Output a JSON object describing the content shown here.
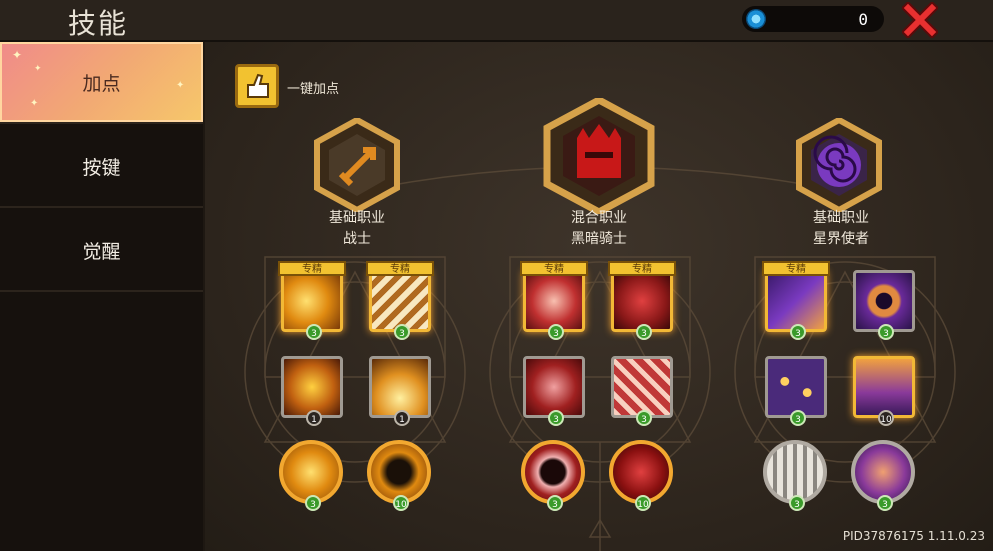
{
  "header": {
    "title": "技能",
    "currency_amount": "0"
  },
  "sidebar": {
    "tabs": [
      {
        "label": "加点",
        "active": true
      },
      {
        "label": "按键",
        "active": false
      },
      {
        "label": "觉醒",
        "active": false
      }
    ]
  },
  "main": {
    "one_key_label": "一键加点",
    "specialty_label": "专精",
    "classes": [
      {
        "type": "基础职业",
        "name": "战士",
        "icon": "sword-icon",
        "color": "#e08a20"
      },
      {
        "type": "混合职业",
        "name": "黑暗骑士",
        "icon": "dark-helmet-icon",
        "color": "#c81818"
      },
      {
        "type": "基础职业",
        "name": "星界使者",
        "icon": "spiral-icon",
        "color": "#7a3ac0"
      }
    ],
    "skill_levels": [
      "3",
      "3",
      "1",
      "1",
      "3",
      "3",
      "3",
      "3",
      "3",
      "3",
      "3",
      "10"
    ],
    "orb_levels": [
      "3",
      "10",
      "3",
      "10",
      "3",
      "3"
    ]
  },
  "footer": {
    "build_id": "PID37876175 1.11.0.23"
  }
}
